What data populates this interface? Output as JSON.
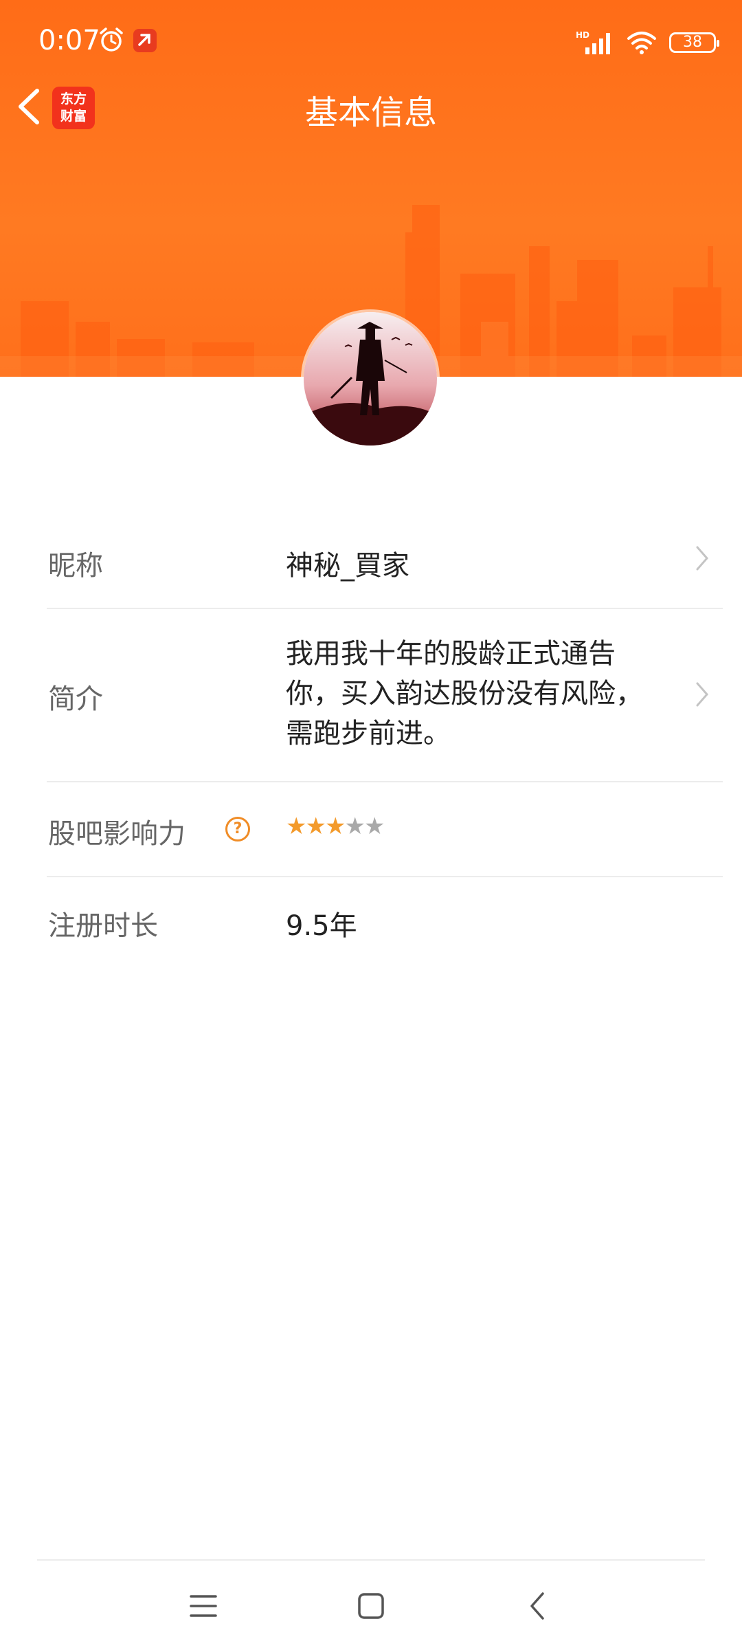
{
  "status_bar": {
    "time": "0:07",
    "network": "HD",
    "battery": "38"
  },
  "header": {
    "title": "基本信息",
    "app_logo": {
      "line1": "东方",
      "line2": "财富"
    }
  },
  "profile": {
    "rows": [
      {
        "label": "昵称",
        "value": "神秘_買家"
      },
      {
        "label": "简介",
        "value_lines": [
          "我用我十年的股龄正式通告",
          "你，买入韵达股份没有风险，",
          "需跑步前进。"
        ]
      },
      {
        "label": "股吧影响力",
        "help": "?",
        "stars_filled": 3,
        "stars_total": 5,
        "stars_text": "★★★★★"
      },
      {
        "label": "注册时长",
        "value": "9.5年"
      }
    ]
  },
  "colors": {
    "brand_orange": "#ff6c17",
    "star_active": "#f39a2b",
    "star_inactive": "#a9a9a9"
  }
}
